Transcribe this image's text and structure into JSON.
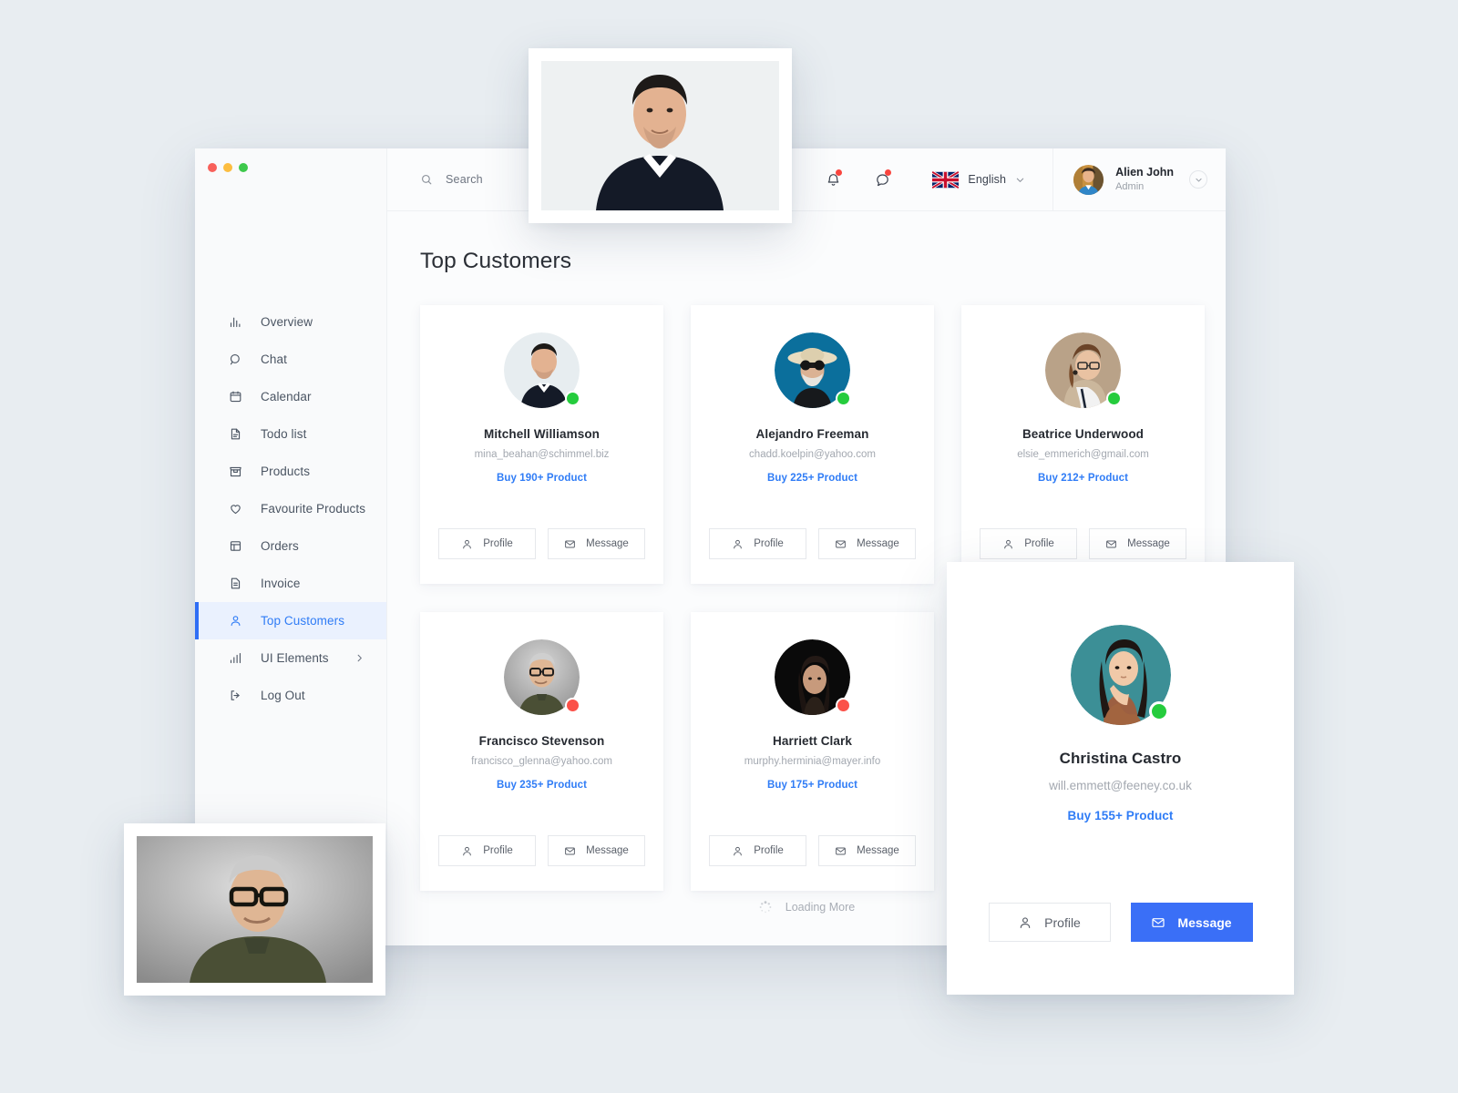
{
  "window": {
    "traffic_lights": [
      "close",
      "minimize",
      "maximize"
    ]
  },
  "sidebar": {
    "items": [
      {
        "label": "Overview",
        "icon": "bar-chart-icon",
        "active": false
      },
      {
        "label": "Chat",
        "icon": "chat-search-icon",
        "active": false
      },
      {
        "label": "Calendar",
        "icon": "calendar-icon",
        "active": false
      },
      {
        "label": "Todo list",
        "icon": "document-icon",
        "active": false
      },
      {
        "label": "Products",
        "icon": "store-icon",
        "active": false
      },
      {
        "label": "Favourite Products",
        "icon": "heart-icon",
        "active": false
      },
      {
        "label": "Orders",
        "icon": "layout-icon",
        "active": false
      },
      {
        "label": "Invoice",
        "icon": "invoice-icon",
        "active": false
      },
      {
        "label": "Top Customers",
        "icon": "user-icon",
        "active": true
      },
      {
        "label": "UI Elements",
        "icon": "chart-bars-icon",
        "active": false,
        "expandable": true
      }
    ],
    "logout": {
      "label": "Log Out",
      "icon": "logout-icon"
    }
  },
  "topbar": {
    "search": {
      "placeholder": "Search",
      "value": "",
      "icon": "search-icon"
    },
    "notification": {
      "icon": "bell-icon",
      "has_badge": true
    },
    "messages": {
      "icon": "chat-bubble-icon",
      "has_badge": true
    },
    "language": {
      "label": "English",
      "flag": "uk-flag-icon",
      "chevron": "chevron-down-icon"
    },
    "profile": {
      "name": "Alien John",
      "role": "Admin",
      "chevron": "chevron-down-icon"
    }
  },
  "main": {
    "title": "Top Customers",
    "loading": {
      "label": "Loading More",
      "icon": "spinner-icon"
    },
    "buttons": {
      "profile_label": "Profile",
      "message_label": "Message",
      "profile_icon": "user-icon",
      "message_icon": "envelope-icon"
    },
    "customers": [
      {
        "name": "Mitchell Williamson",
        "email": "mina_beahan@schimmel.biz",
        "buy": "Buy 190+ Product",
        "status": "online"
      },
      {
        "name": "Alejandro Freeman",
        "email": "chadd.koelpin@yahoo.com",
        "buy": "Buy 225+ Product",
        "status": "online"
      },
      {
        "name": "Beatrice Underwood",
        "email": "elsie_emmerich@gmail.com",
        "buy": "Buy 212+ Product",
        "status": "online"
      },
      {
        "name": "Francisco Stevenson",
        "email": "francisco_glenna@yahoo.com",
        "buy": "Buy 235+ Product",
        "status": "busy"
      },
      {
        "name": "Harriett Clark",
        "email": "murphy.herminia@mayer.info",
        "buy": "Buy 175+ Product",
        "status": "busy"
      }
    ]
  },
  "detached_card": {
    "name": "Christina Castro",
    "email": "will.emmett@feeney.co.uk",
    "buy": "Buy 155+ Product",
    "status": "online",
    "profile_label": "Profile",
    "message_label": "Message"
  },
  "colors": {
    "accent": "#2f7cf6",
    "primary_button": "#3a6ff7",
    "online": "#25cc3d",
    "busy": "#fb5149",
    "page_bg": "#e8edf1",
    "sidebar_bg": "#f9fafb",
    "active_nav_bg": "#eaf1fe"
  }
}
